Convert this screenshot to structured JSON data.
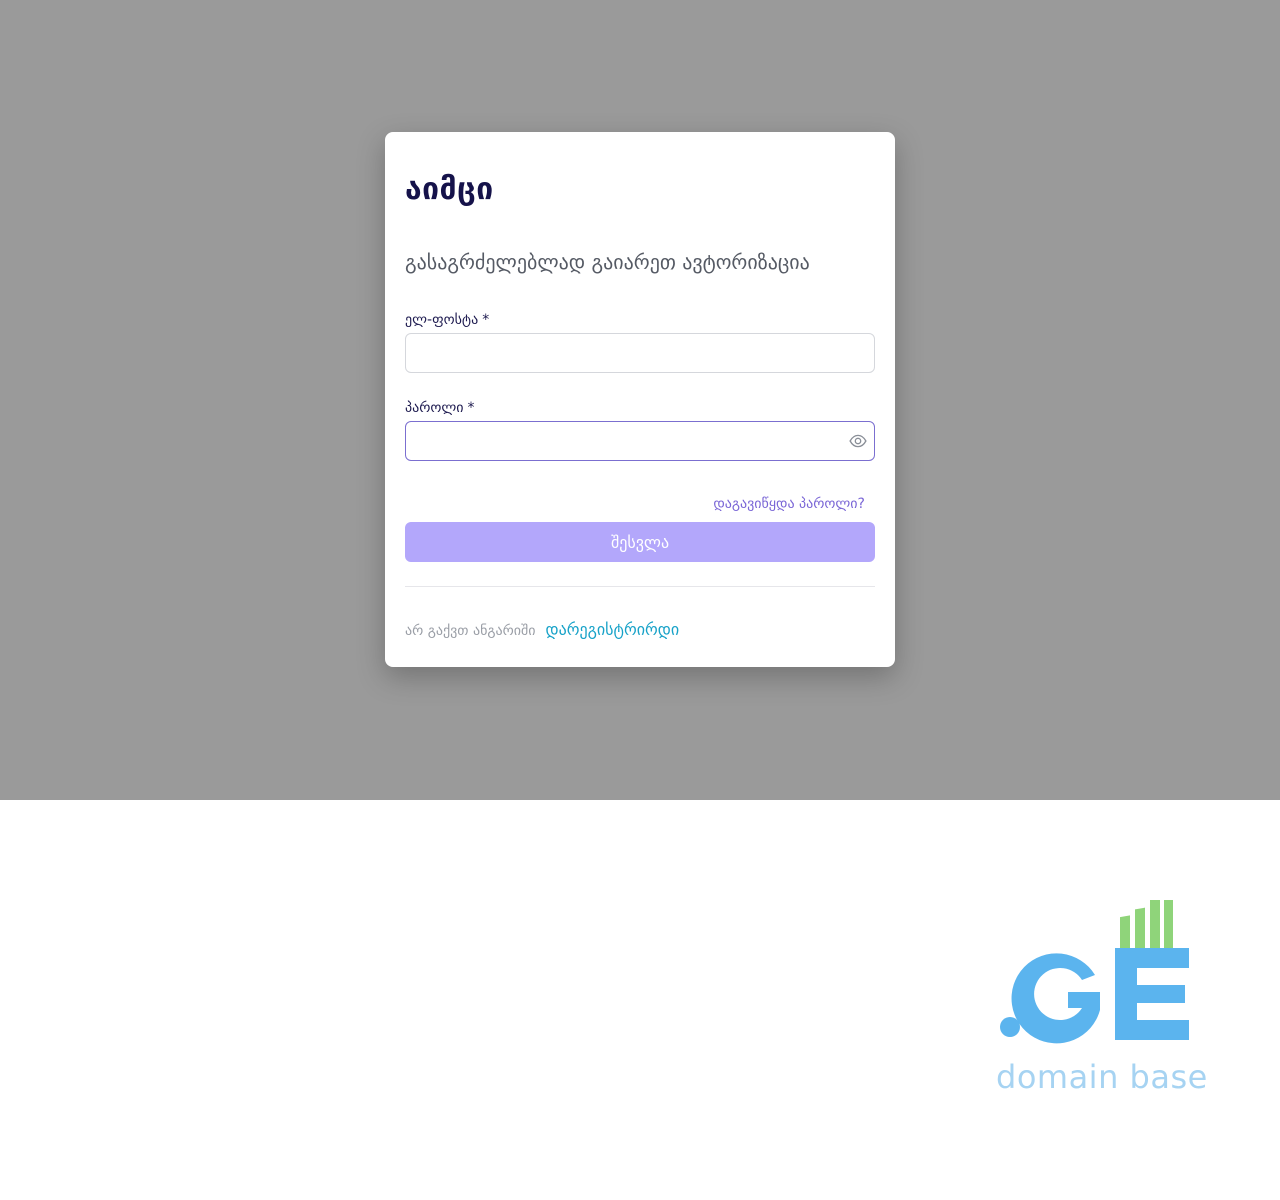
{
  "app": {
    "brand_title": "აიმცი",
    "subtitle": "გასაგრძელებლად გაიარეთ ავტორიზაცია"
  },
  "form": {
    "email_label": "ელ-ფოსტა",
    "email_required": "*",
    "email_value": "",
    "password_label": "პაროლი",
    "password_required": "*",
    "password_value": "",
    "forgot_label": "დაგავიწყდა პაროლი?",
    "submit_label": "შესვლა",
    "no_account_text": "არ გაქვთ ანგარიში",
    "register_label": "დარეგისტრირდი"
  },
  "icons": {
    "password_toggle": "eye-icon"
  },
  "watermark": {
    "logo_text": "domain base"
  },
  "colors": {
    "overlay": "#9a9a9a",
    "accent": "#7a66d6",
    "button": "#b3a7fb",
    "link": "#17a2c8",
    "logo_blue": "#5bb4ee",
    "logo_green": "#8fd47a"
  }
}
